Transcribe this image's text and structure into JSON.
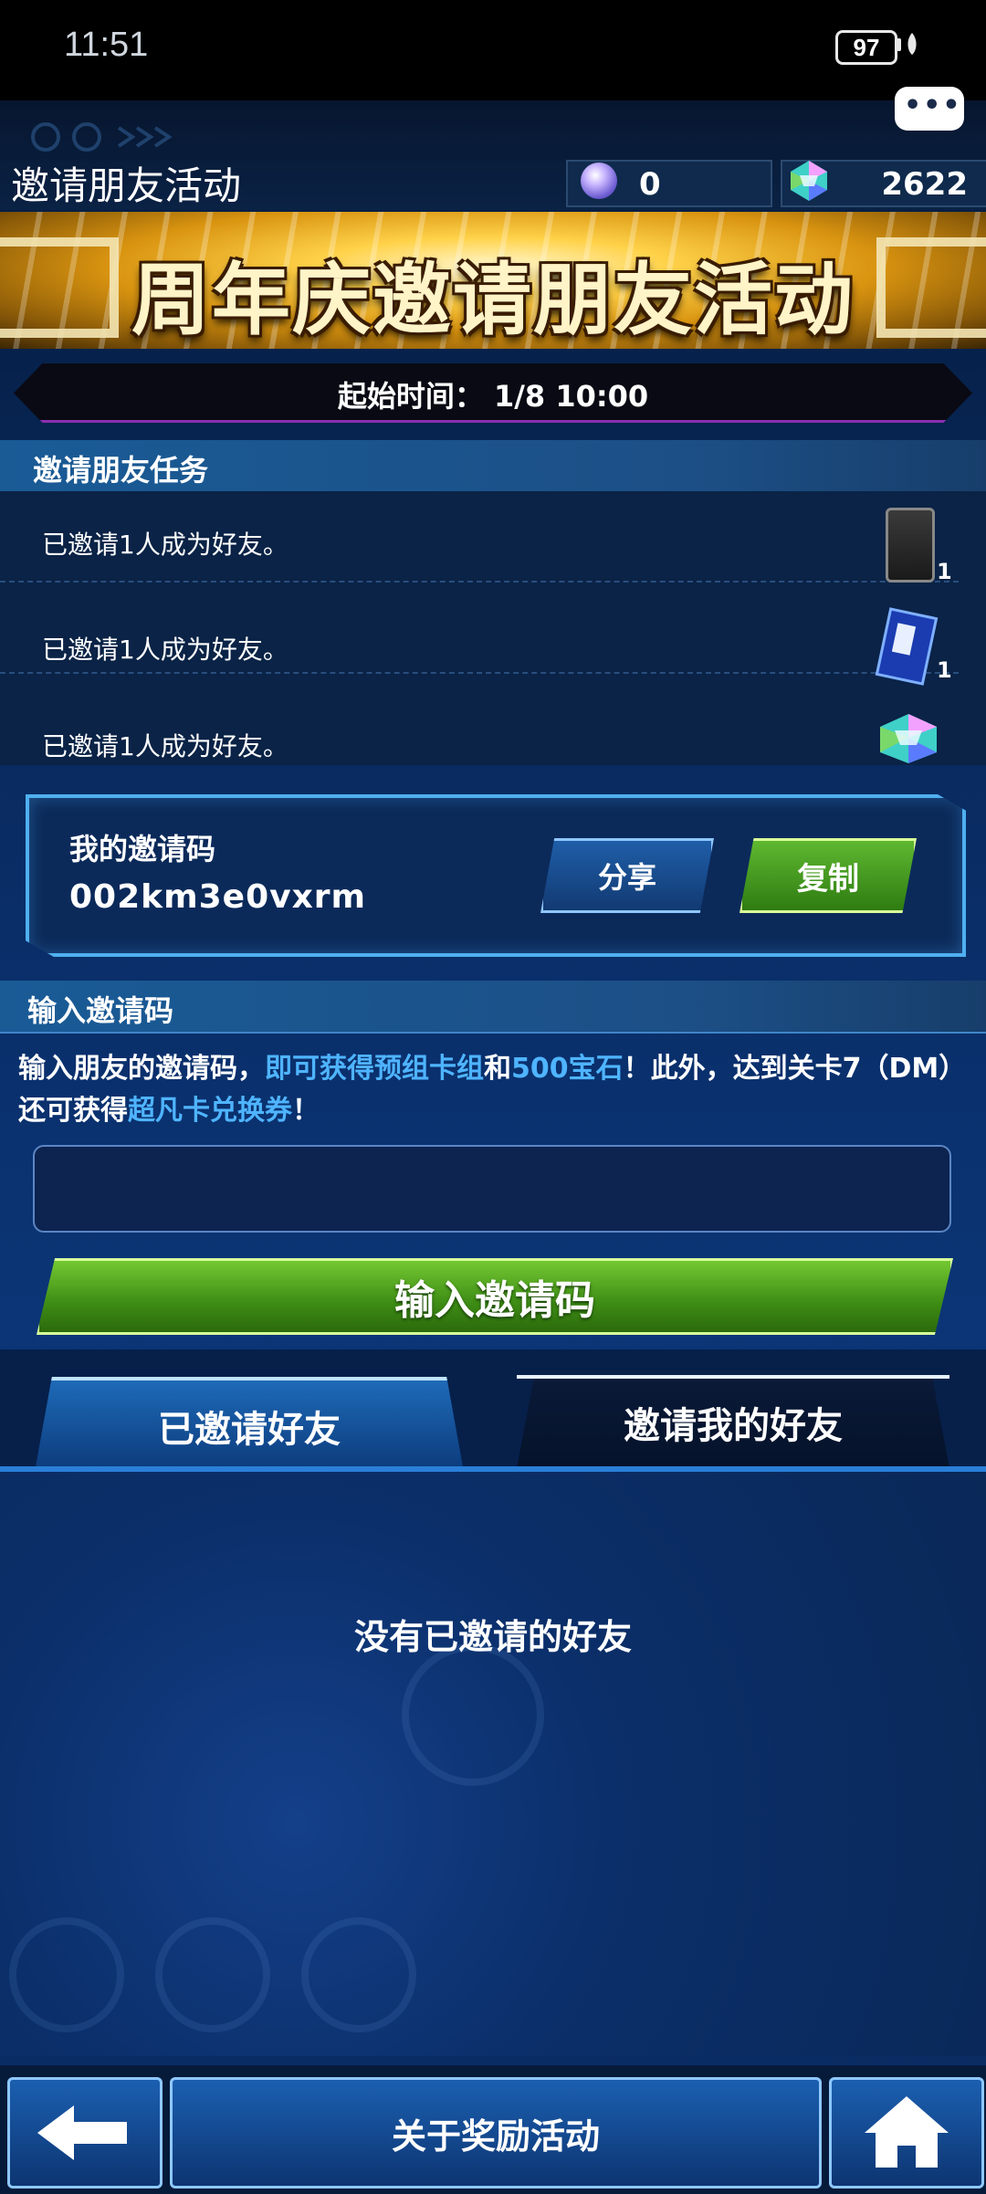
{
  "status_bar": {
    "time": "11:51",
    "battery": "97"
  },
  "header": {
    "title": "邀请朋友活动",
    "orb_count": "0",
    "gem_count": "2622"
  },
  "banner": {
    "title": "周年庆邀请朋友活动",
    "start_time": "起始时间： 1/8 10:00"
  },
  "tasks": {
    "heading": "邀请朋友任务",
    "items": [
      {
        "label": "已邀请1人成为好友。",
        "reward_icon": "card-sleeve-icon",
        "count": "1"
      },
      {
        "label": "已邀请1人成为好友。",
        "reward_icon": "card-ticket-icon",
        "count": "1"
      },
      {
        "label": "已邀请1人成为好友。",
        "reward_icon": "gem-icon",
        "count": ""
      }
    ]
  },
  "my_code": {
    "label": "我的邀请码",
    "code": "002km3e0vxrm",
    "share": "分享",
    "copy": "复制"
  },
  "enter_code": {
    "heading": "输入邀请码",
    "desc_p1": "输入朋友的邀请码，",
    "desc_h1": "即可获得预组卡组",
    "desc_p2": "和",
    "desc_h2": "500宝石",
    "desc_p3": "！此外，达到关卡7（DM）还可获得",
    "desc_h3": "超凡卡兑换券",
    "desc_p4": "！",
    "input_value": "",
    "button": "输入邀请码"
  },
  "tabs": {
    "invited": "已邀请好友",
    "invited_me": "邀请我的好友"
  },
  "friends": {
    "empty": "没有已邀请的好友"
  },
  "bottom": {
    "reward": "关于奖励活动"
  },
  "colors": {
    "accent_blue": "#4fb4ff",
    "green_button": "#3d8c15",
    "banner_gold": "#ffd24a"
  }
}
